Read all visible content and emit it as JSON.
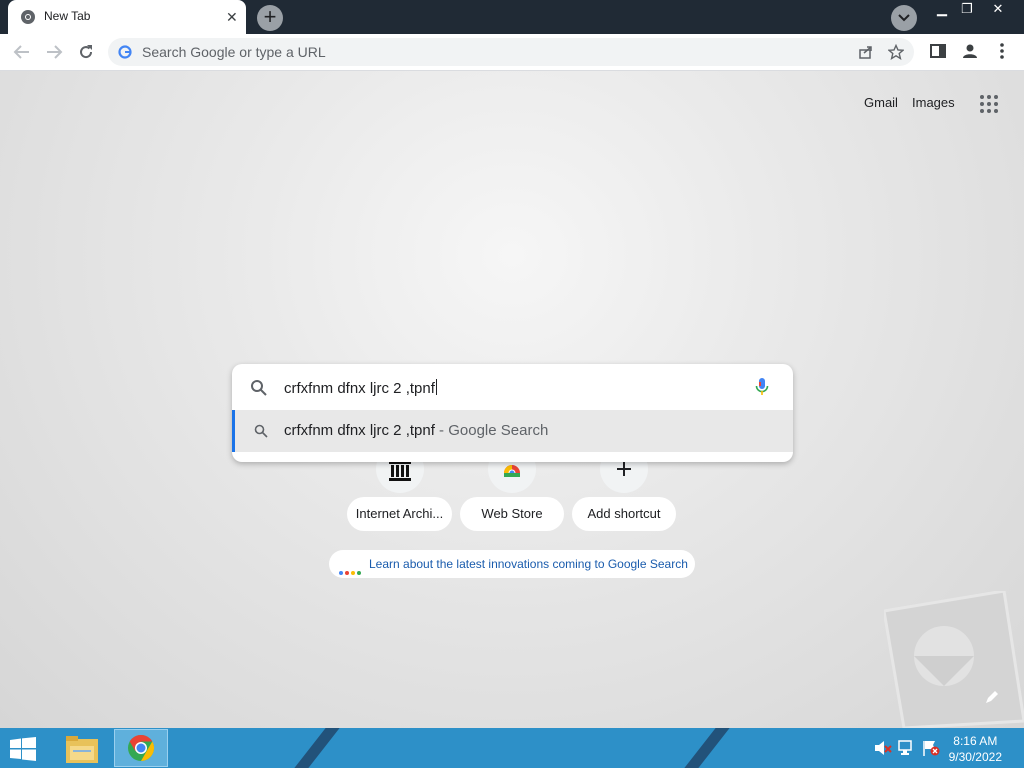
{
  "browser": {
    "tab": {
      "title": "New Tab",
      "close_glyph": "✕"
    },
    "new_tab_glyph": "+",
    "window_controls": {
      "minimize": "▁",
      "maximize": "❐",
      "close": "✕"
    },
    "omnibox": {
      "placeholder": "Search Google or type a URL"
    }
  },
  "ntp": {
    "top_links": {
      "gmail": "Gmail",
      "images": "Images"
    },
    "search": {
      "query": "crfxfnm dfnx ljrc 2 ,tpnf",
      "suggestion": "crfxfnm dfnx ljrc 2 ,tpnf",
      "suggestion_suffix": " - Google Search"
    },
    "shortcuts": [
      {
        "label": "Internet Archi...",
        "icon": "internet-archive-icon"
      },
      {
        "label": "Web Store",
        "icon": "chrome-web-store-icon"
      },
      {
        "label": "Add shortcut",
        "icon": "plus-icon"
      }
    ],
    "promo": {
      "text": "Learn about the latest innovations coming to Google Search",
      "dot_colors": [
        "#4285f4",
        "#ea4335",
        "#fbbc05",
        "#34a853"
      ]
    }
  },
  "taskbar": {
    "clock": {
      "time": "8:16 AM",
      "date": "9/30/2022"
    }
  },
  "colors": {
    "titlebar": "#202a35",
    "taskbar": "#2d90c8",
    "link": "#1a5cad",
    "accent": "#1a73e8"
  }
}
